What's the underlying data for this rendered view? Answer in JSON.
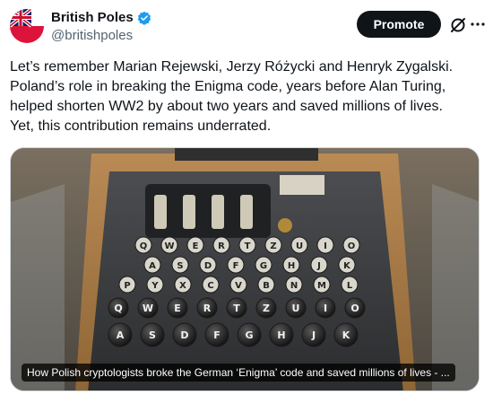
{
  "account": {
    "display_name": "British Poles",
    "handle": "@britishpoles",
    "verified": true
  },
  "actions": {
    "promote_label": "Promote"
  },
  "icons": {
    "avatar": "union-jack-poland-avatar",
    "verified": "verified-badge-icon",
    "grok": "grok-icon",
    "more": "more-icon"
  },
  "colors": {
    "verified_blue": "#1d9bf0",
    "text_primary": "#0f1419",
    "text_secondary": "#536471",
    "button_bg": "#0f1419"
  },
  "tweet": {
    "text": "Let’s remember Marian Rejewski, Jerzy Różycki and Henryk Zygalski.\nPoland’s role in breaking the Enigma code, years before Alan Turing,\nhelped shorten WW2 by about two years and saved millions of lives.\nYet, this contribution remains underrated."
  },
  "media": {
    "caption": "How Polish cryptologists broke the German ‘Enigma’ code and saved millions of lives - ...",
    "keyboard_rows": [
      [
        "Q",
        "W",
        "E",
        "R",
        "T",
        "Z",
        "U",
        "I",
        "O"
      ],
      [
        "A",
        "S",
        "D",
        "F",
        "G",
        "H",
        "J",
        "K"
      ],
      [
        "P",
        "Y",
        "X",
        "C",
        "V",
        "B",
        "N",
        "M",
        "L"
      ],
      [
        "Q",
        "W",
        "E",
        "R",
        "T",
        "Z",
        "U",
        "I",
        "O"
      ],
      [
        "A",
        "S",
        "D",
        "F",
        "G",
        "H",
        "J",
        "K"
      ]
    ]
  }
}
